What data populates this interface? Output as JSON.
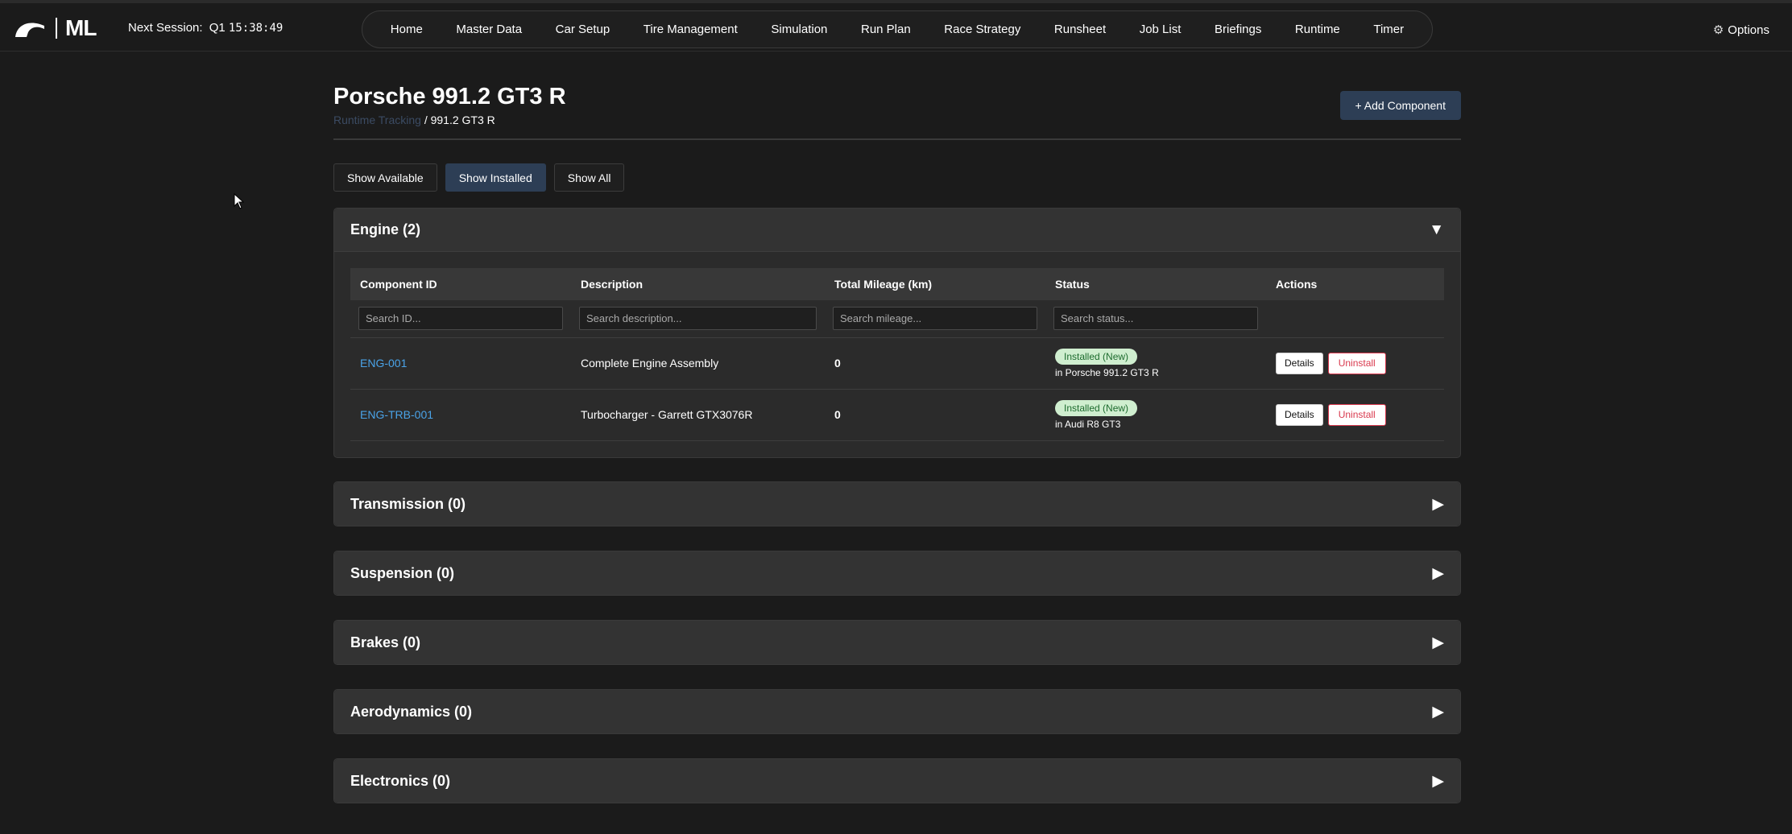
{
  "header": {
    "logo_text": "ML",
    "next_session_label": "Next Session:",
    "next_session_name": "Q1",
    "next_session_time": "15:38:49",
    "nav": [
      "Home",
      "Master Data",
      "Car Setup",
      "Tire Management",
      "Simulation",
      "Run Plan",
      "Race Strategy",
      "Runsheet",
      "Job List",
      "Briefings",
      "Runtime",
      "Timer"
    ],
    "options_label": "Options",
    "options_icon": "gear-icon"
  },
  "page": {
    "title": "Porsche 991.2 GT3 R",
    "breadcrumb_link": "Runtime Tracking",
    "breadcrumb_current": "/ 991.2 GT3 R",
    "add_button": "+ Add Component"
  },
  "filters": [
    {
      "label": "Show Available",
      "active": false
    },
    {
      "label": "Show Installed",
      "active": true
    },
    {
      "label": "Show All",
      "active": false
    }
  ],
  "table": {
    "columns": [
      "Component ID",
      "Description",
      "Total Mileage (km)",
      "Status",
      "Actions"
    ],
    "placeholders": [
      "Search ID...",
      "Search description...",
      "Search mileage...",
      "Search status..."
    ],
    "details_label": "Details",
    "uninstall_label": "Uninstall"
  },
  "sections": [
    {
      "title": "Engine (2)",
      "open": true,
      "arrow": "▼",
      "rows": [
        {
          "id": "ENG-001",
          "description": "Complete Engine Assembly",
          "mileage": "0",
          "status": "Installed (New)",
          "location": "in Porsche 991.2 GT3 R"
        },
        {
          "id": "ENG-TRB-001",
          "description": "Turbocharger - Garrett GTX3076R",
          "mileage": "0",
          "status": "Installed (New)",
          "location": "in Audi R8 GT3"
        }
      ]
    },
    {
      "title": "Transmission (0)",
      "open": false,
      "arrow": "▶"
    },
    {
      "title": "Suspension (0)",
      "open": false,
      "arrow": "▶"
    },
    {
      "title": "Brakes (0)",
      "open": false,
      "arrow": "▶"
    },
    {
      "title": "Aerodynamics (0)",
      "open": false,
      "arrow": "▶"
    },
    {
      "title": "Electronics (0)",
      "open": false,
      "arrow": "▶"
    }
  ],
  "colors": {
    "background": "#1b1b1b",
    "accent": "#2d3e55",
    "link": "#4aa3e8",
    "badge_bg": "#cfeecf",
    "danger": "#d9394e"
  }
}
